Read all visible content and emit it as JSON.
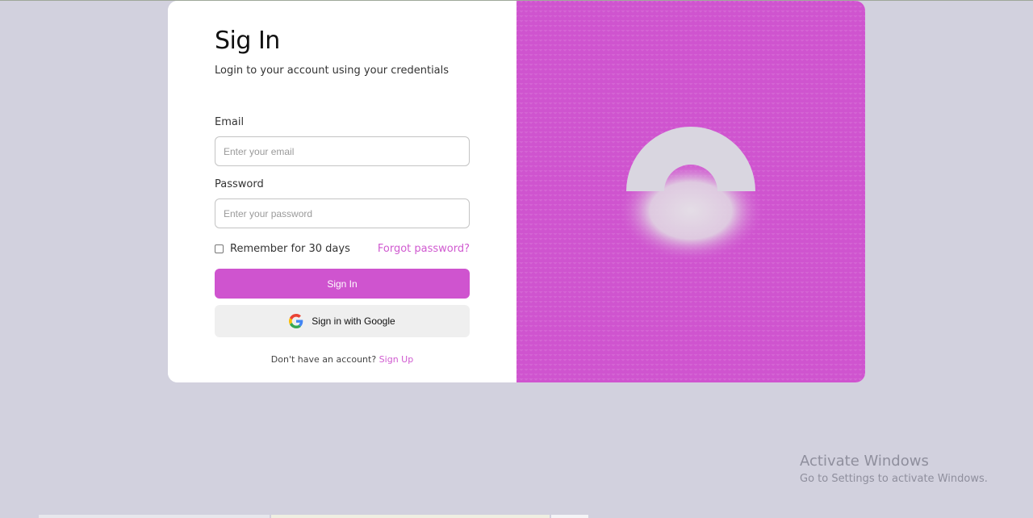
{
  "signin": {
    "title": "Sig In",
    "subtitle": "Login to your account using your credentials",
    "email_label": "Email",
    "email_placeholder": "Enter your email",
    "email_value": "",
    "password_label": "Password",
    "password_placeholder": "Enter your password",
    "password_value": "",
    "remember_label": "Remember for 30 days",
    "remember_checked": false,
    "forgot_label": "Forgot password?",
    "submit_label": "Sign In",
    "google_label": "Sign in with Google",
    "signup_prompt": "Don't have an account?",
    "signup_link": "Sign Up"
  },
  "watermark": {
    "title": "Activate Windows",
    "subtitle": "Go to Settings to activate Windows."
  },
  "colors": {
    "accent": "#cf54cf",
    "background": "#d2d1de",
    "google_button_bg": "#efefef"
  },
  "icons": {
    "google": "google-g-icon",
    "illustration": "lock-icon"
  }
}
